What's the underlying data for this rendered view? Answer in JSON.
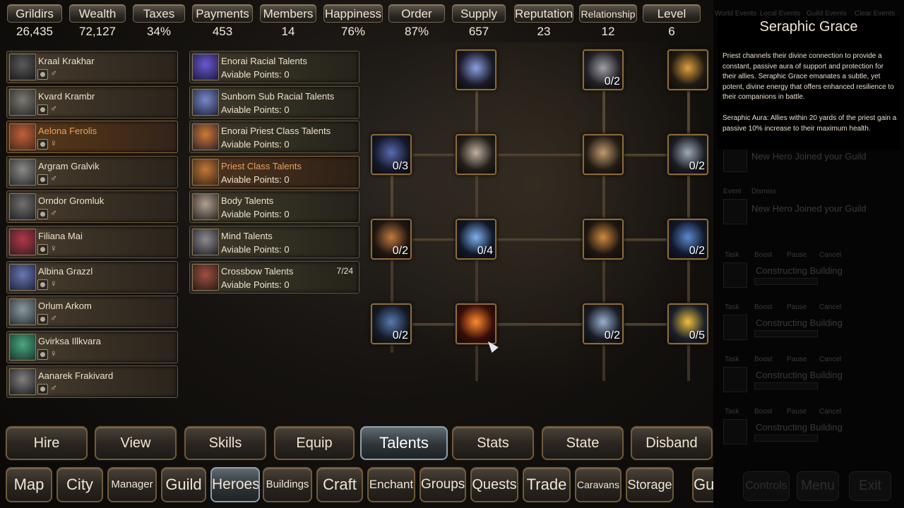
{
  "stats": [
    {
      "label": "Grildirs",
      "value": "26,435"
    },
    {
      "label": "Wealth",
      "value": "72,127"
    },
    {
      "label": "Taxes",
      "value": "34%"
    },
    {
      "label": "Payments",
      "value": "453"
    },
    {
      "label": "Members",
      "value": "14"
    },
    {
      "label": "Happiness",
      "value": "76%"
    },
    {
      "label": "Order",
      "value": "87%"
    },
    {
      "label": "Supply",
      "value": "657"
    },
    {
      "label": "Reputation",
      "value": "23"
    },
    {
      "label": "Relationship",
      "value": "12"
    },
    {
      "label": "Level",
      "value": "6"
    }
  ],
  "heroes": [
    {
      "name": "Kraal Krakhar",
      "gender": "♂",
      "selected": false
    },
    {
      "name": "Kvard Krambr",
      "gender": "♂",
      "selected": false
    },
    {
      "name": "Aelona Ferolis",
      "gender": "♀",
      "selected": true
    },
    {
      "name": "Argram Gralvik",
      "gender": "♂",
      "selected": false
    },
    {
      "name": "Orndor Gromluk",
      "gender": "♂",
      "selected": false
    },
    {
      "name": "Filiana Mai",
      "gender": "♀",
      "selected": false
    },
    {
      "name": "Albina Grazzl",
      "gender": "♀",
      "selected": false
    },
    {
      "name": "Orlum Arkom",
      "gender": "♂",
      "selected": false
    },
    {
      "name": "Gvirksa Illkvara",
      "gender": "♀",
      "selected": false
    },
    {
      "name": "Aanarek Frakivard",
      "gender": "♂",
      "selected": false
    }
  ],
  "talent_categories": [
    {
      "name": "Enorai Racial Talents",
      "points": "Aviable Points: 0",
      "extra": "",
      "selected": false
    },
    {
      "name": "Sunborn Sub Racial Talents",
      "points": "Aviable Points: 0",
      "extra": "",
      "selected": false
    },
    {
      "name": "Enorai Priest Class Talents",
      "points": "Aviable Points: 0",
      "extra": "",
      "selected": false
    },
    {
      "name": "Priest Class Talents",
      "points": "Aviable Points: 0",
      "extra": "",
      "selected": true
    },
    {
      "name": "Body Talents",
      "points": "Aviable Points: 0",
      "extra": "",
      "selected": false
    },
    {
      "name": "Mind Talents",
      "points": "Aviable Points: 0",
      "extra": "",
      "selected": false
    },
    {
      "name": "Crossbow Talents",
      "points": "Aviable Points: 0",
      "extra": "7/24",
      "selected": false
    }
  ],
  "talent_nodes": [
    {
      "id": "r0c1",
      "count": ""
    },
    {
      "id": "r0c3",
      "count": "0/2"
    },
    {
      "id": "r0c4",
      "count": ""
    },
    {
      "id": "r1c0",
      "count": "0/3"
    },
    {
      "id": "r1c1",
      "count": ""
    },
    {
      "id": "r1c3",
      "count": ""
    },
    {
      "id": "r1c4",
      "count": "0/2"
    },
    {
      "id": "r2c0",
      "count": "0/2"
    },
    {
      "id": "r2c1",
      "count": "0/4"
    },
    {
      "id": "r2c3",
      "count": ""
    },
    {
      "id": "r2c4",
      "count": "0/2"
    },
    {
      "id": "r3c0",
      "count": "0/2"
    },
    {
      "id": "r3c1",
      "count": ""
    },
    {
      "id": "r3c3",
      "count": "0/2"
    },
    {
      "id": "r3c4",
      "count": "0/5"
    }
  ],
  "hero_tabs": [
    {
      "label": "Hire",
      "active": false
    },
    {
      "label": "View",
      "active": false
    },
    {
      "label": "Skills",
      "active": false
    },
    {
      "label": "Equip",
      "active": false
    },
    {
      "label": "Talents",
      "active": true
    },
    {
      "label": "Stats",
      "active": false
    },
    {
      "label": "State",
      "active": false
    },
    {
      "label": "Disband",
      "active": false
    }
  ],
  "nav_buttons": [
    {
      "label": "Map",
      "active": false
    },
    {
      "label": "City",
      "active": false
    },
    {
      "label": "Manager",
      "active": false
    },
    {
      "label": "Guild",
      "active": false
    },
    {
      "label": "Heroes",
      "active": true
    },
    {
      "label": "Buildings",
      "active": false
    },
    {
      "label": "Craft",
      "active": false
    },
    {
      "label": "Enchant",
      "active": false
    },
    {
      "label": "Groups",
      "active": false
    },
    {
      "label": "Quests",
      "active": false
    },
    {
      "label": "Trade",
      "active": false
    },
    {
      "label": "Caravans",
      "active": false
    },
    {
      "label": "Storage",
      "active": false
    },
    {
      "label": "Guide",
      "active": false
    }
  ],
  "right_panel": {
    "header_tabs": [
      "World Events",
      "Local Events",
      "Guild Events",
      "Clear Events"
    ],
    "events": [
      {
        "tag": "Event",
        "action": "Dismiss",
        "text": "New Hero Joined your Guild"
      },
      {
        "tag": "Event",
        "action": "Dismiss",
        "text": "New Hero Joined your Guild"
      },
      {
        "tag": "Event",
        "action": "Dismiss",
        "text": "New Hero Joined your Guild"
      }
    ],
    "tasks": [
      {
        "tag": "Task",
        "buttons": [
          "Boost",
          "Pause",
          "Cancel"
        ],
        "text": "Constructing Building"
      },
      {
        "tag": "Task",
        "buttons": [
          "Boost",
          "Pause",
          "Cancel"
        ],
        "text": "Constructing Building"
      },
      {
        "tag": "Task",
        "buttons": [
          "Boost",
          "Pause",
          "Cancel"
        ],
        "text": "Constructing Building"
      },
      {
        "tag": "Task",
        "buttons": [
          "Boost",
          "Pause",
          "Cancel"
        ],
        "text": "Constructing Building"
      }
    ],
    "bottom_buttons": [
      "Controls",
      "Menu",
      "Exit"
    ]
  },
  "tooltip": {
    "title": "Seraphic Grace",
    "paragraph1": "Priest channels their divine connection to provide a constant, passive aura of support and protection for their allies. Seraphic Grace emanates a subtle, yet potent, divine energy that offers enhanced resilience to their companions in battle.",
    "paragraph2": "Seraphic Aura: Allies within 20 yards of the priest gain a passive 10% increase to their maximum health."
  },
  "colors": {
    "selected_text": "#e9a15c",
    "frame_gold": "#8a6a3a",
    "active_button": "#5f6a72"
  }
}
